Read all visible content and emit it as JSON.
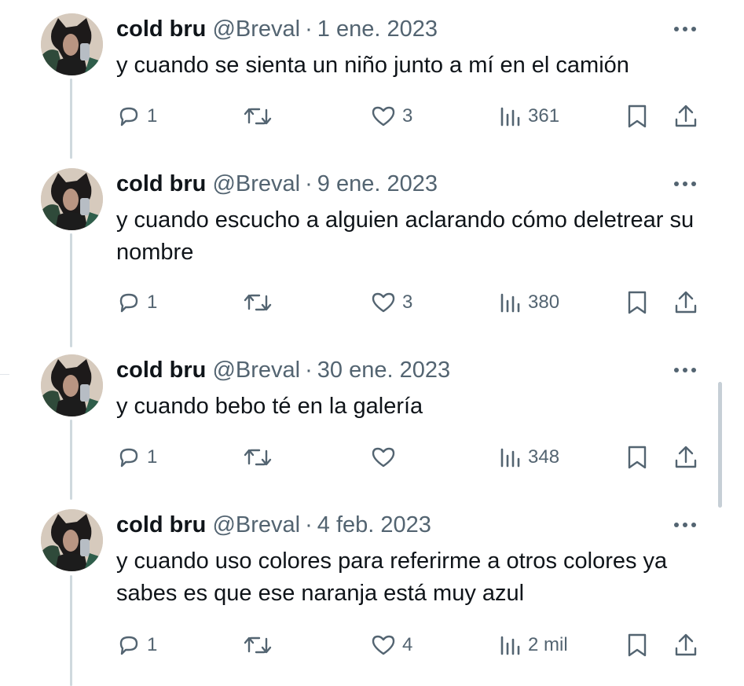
{
  "tweets": [
    {
      "name": "cold bru",
      "handle": "@Breval",
      "separator": "·",
      "date": "1 ene. 2023",
      "text": "y cuando se sienta un niño junto a mí en el camión",
      "replies": "1",
      "retweets": "",
      "likes": "3",
      "views": "361"
    },
    {
      "name": "cold bru",
      "handle": "@Breval",
      "separator": "·",
      "date": "9 ene. 2023",
      "text": "y cuando escucho a alguien aclarando cómo deletrear su nombre",
      "replies": "1",
      "retweets": "",
      "likes": "3",
      "views": "380"
    },
    {
      "name": "cold bru",
      "handle": "@Breval",
      "separator": "·",
      "date": "30 ene. 2023",
      "text": "y cuando bebo té en la galería",
      "replies": "1",
      "retweets": "",
      "likes": "",
      "views": "348"
    },
    {
      "name": "cold bru",
      "handle": "@Breval",
      "separator": "·",
      "date": "4 feb. 2023",
      "text": "y cuando uso colores para referirme a otros colores ya sabes es que ese naranja está muy azul",
      "replies": "1",
      "retweets": "",
      "likes": "4",
      "views": "2 mil"
    }
  ],
  "icons": {
    "more": "more-icon",
    "reply": "reply-icon",
    "retweet": "retweet-icon",
    "like": "like-icon",
    "views": "views-icon",
    "bookmark": "bookmark-icon",
    "share": "share-icon"
  },
  "colors": {
    "text_primary": "#0f1419",
    "text_secondary": "#536471",
    "thread_line": "#cfd9de"
  }
}
